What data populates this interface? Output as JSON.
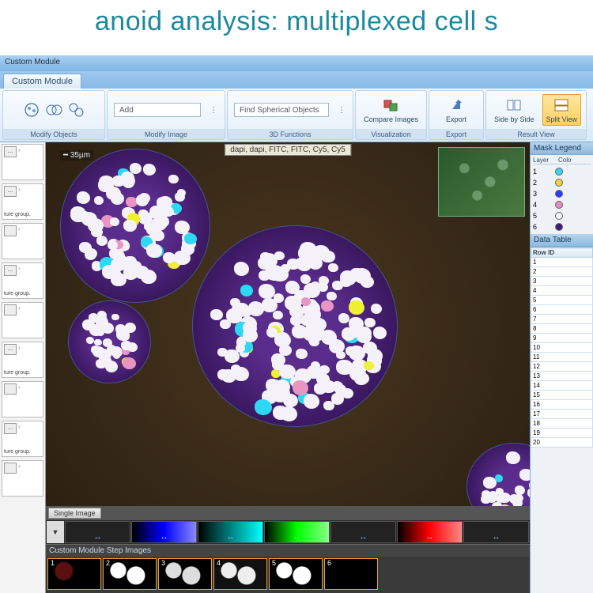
{
  "title": "anoid analysis: multiplexed cell s",
  "menubar": "Custom Module",
  "tab": "Custom Module",
  "ribbon": {
    "modify_objects": {
      "label": "Modify Objects"
    },
    "modify_image": {
      "label": "Modify Image",
      "add": "Add"
    },
    "functions3d": {
      "label": "3D Functions",
      "find": "Find Spherical Objects"
    },
    "visualization": {
      "label": "Visualization",
      "compare": "Compare Images"
    },
    "export": {
      "label": "Export",
      "btn": "Export"
    },
    "result_view": {
      "label": "Result View",
      "side": "Side by Side",
      "split": "Split View"
    }
  },
  "left_items": [
    {
      "btn": "...",
      "lab": ""
    },
    {
      "btn": "...",
      "lab": "ture group."
    },
    {
      "btn": "",
      "lab": ""
    },
    {
      "btn": "...",
      "lab": "ture group."
    },
    {
      "btn": "",
      "lab": ""
    },
    {
      "btn": "...",
      "lab": "ture group."
    },
    {
      "btn": "",
      "lab": ""
    },
    {
      "btn": "...",
      "lab": "ture group."
    },
    {
      "btn": "",
      "lab": ""
    }
  ],
  "image": {
    "scalebar": "35µm",
    "channels": "dapi, dapi, FITC, FITC, Cy5, Cy5",
    "tab": "Single Image"
  },
  "steps": {
    "head": "Custom Module Step Images",
    "labels": [
      "1",
      "2",
      "3",
      "4",
      "5",
      "6"
    ]
  },
  "legend": {
    "head": "Mask Legend",
    "hdr": {
      "layer": "Layer",
      "color": "Colo"
    },
    "rows": [
      {
        "n": "1",
        "c": "#35d5ef"
      },
      {
        "n": "2",
        "c": "#f2d23a"
      },
      {
        "n": "3",
        "c": "#2a3cff"
      },
      {
        "n": "4",
        "c": "#e88ac2"
      },
      {
        "n": "5",
        "c": "#f2f0f4"
      },
      {
        "n": "6",
        "c": "#3e1a78"
      }
    ]
  },
  "datatable": {
    "head": "Data Table",
    "col": "Row ID",
    "rows": [
      "1",
      "2",
      "3",
      "4",
      "5",
      "6",
      "7",
      "8",
      "9",
      "10",
      "11",
      "12",
      "13",
      "14",
      "15",
      "16",
      "17",
      "18",
      "19",
      "20"
    ]
  }
}
